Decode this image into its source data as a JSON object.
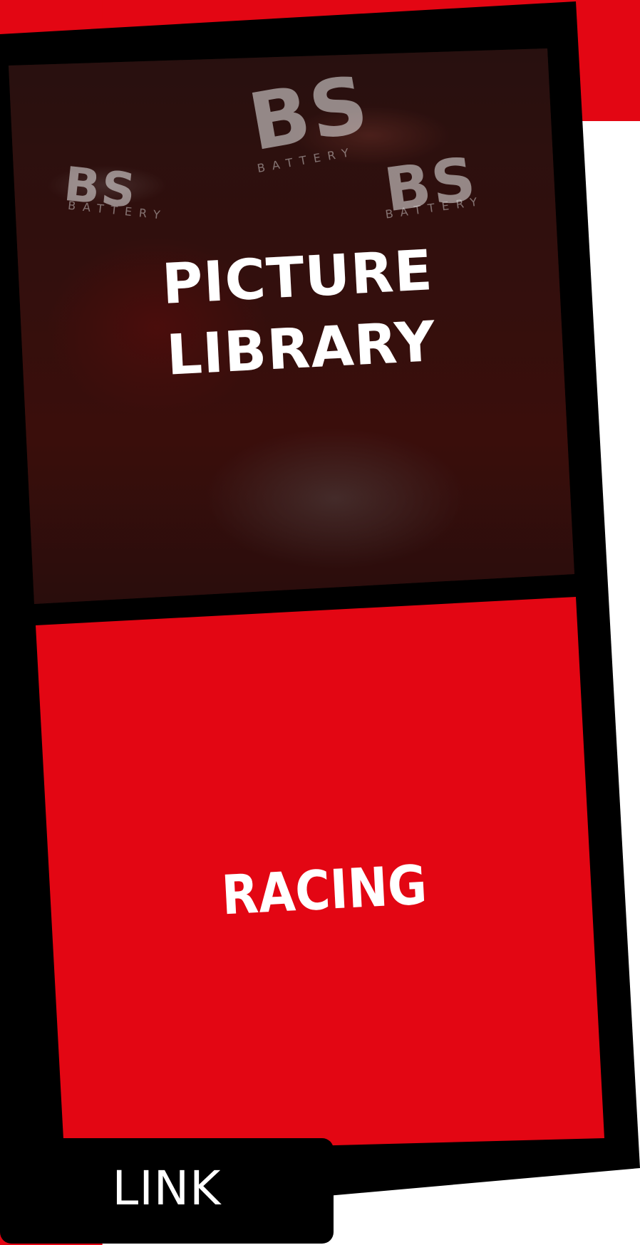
{
  "colors": {
    "brand_red": "#e30613",
    "frame_black": "#000000",
    "text_white": "#ffffff"
  },
  "picture_panel": {
    "title_line1": "PICTURE",
    "title_line2": "LIBRARY",
    "photo_signage": [
      "BS",
      "BS",
      "BS"
    ],
    "photo_signage_sub": [
      "BATTERY",
      "BATTERY",
      "BATTERY"
    ]
  },
  "racing_panel": {
    "title": "RACING"
  },
  "link_button": {
    "label": "LINK"
  }
}
